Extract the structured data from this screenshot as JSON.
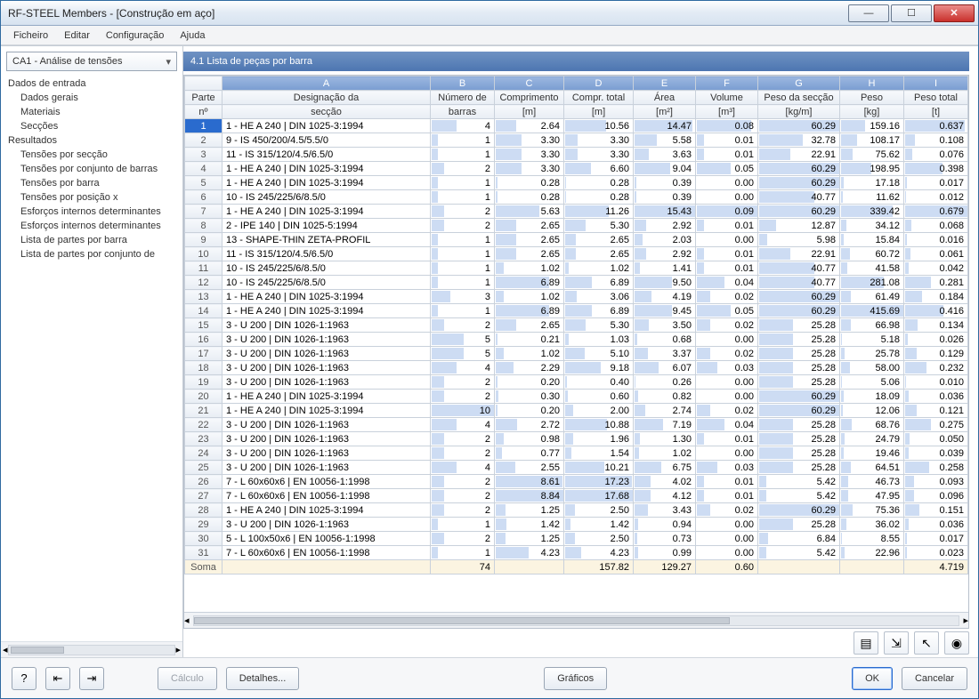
{
  "window": {
    "title": "RF-STEEL Members - [Construção em aço]"
  },
  "menu": [
    "Ficheiro",
    "Editar",
    "Configuração",
    "Ajuda"
  ],
  "sidebar": {
    "combo": "CA1 - Análise de tensões",
    "groups": [
      {
        "label": "Dados de entrada",
        "items": [
          "Dados gerais",
          "Materiais",
          "Secções"
        ]
      },
      {
        "label": "Resultados",
        "items": [
          "Tensões por secção",
          "Tensões por conjunto de barras",
          "Tensões por barra",
          "Tensões por posição x",
          "Esforços internos determinantes",
          "Esforços internos determinantes",
          "Lista de partes por barra",
          "Lista de partes por conjunto de"
        ]
      }
    ]
  },
  "panel": {
    "title": "4.1 Lista de peças por barra",
    "letters": [
      "A",
      "B",
      "C",
      "D",
      "E",
      "F",
      "G",
      "H",
      "I"
    ],
    "headers": [
      {
        "l1": "Parte",
        "l2": "nº"
      },
      {
        "l1": "Designação da",
        "l2": "secção"
      },
      {
        "l1": "Número de",
        "l2": "barras"
      },
      {
        "l1": "Comprimento",
        "l2": "[m]"
      },
      {
        "l1": "Compr. total",
        "l2": "[m]"
      },
      {
        "l1": "Área",
        "l2": "[m²]"
      },
      {
        "l1": "Volume",
        "l2": "[m³]"
      },
      {
        "l1": "Peso da secção",
        "l2": "[kg/m]"
      },
      {
        "l1": "Peso",
        "l2": "[kg]"
      },
      {
        "l1": "Peso total",
        "l2": "[t]"
      }
    ],
    "rows": [
      {
        "n": "1",
        "desc": "1 - HE A 240 | DIN 1025-3:1994",
        "nb": "4",
        "len": "2.64",
        "tot": "10.56",
        "area": "14.47",
        "vol": "0.08",
        "gw": "60.29",
        "w": "159.16",
        "wt": "0.637",
        "sel": true
      },
      {
        "n": "2",
        "desc": "9 - IS 450/200/4.5/5.5/0",
        "nb": "1",
        "len": "3.30",
        "tot": "3.30",
        "area": "5.58",
        "vol": "0.01",
        "gw": "32.78",
        "w": "108.17",
        "wt": "0.108"
      },
      {
        "n": "3",
        "desc": "11 - IS 315/120/4.5/6.5/0",
        "nb": "1",
        "len": "3.30",
        "tot": "3.30",
        "area": "3.63",
        "vol": "0.01",
        "gw": "22.91",
        "w": "75.62",
        "wt": "0.076"
      },
      {
        "n": "4",
        "desc": "1 - HE A 240 | DIN 1025-3:1994",
        "nb": "2",
        "len": "3.30",
        "tot": "6.60",
        "area": "9.04",
        "vol": "0.05",
        "gw": "60.29",
        "w": "198.95",
        "wt": "0.398"
      },
      {
        "n": "5",
        "desc": "1 - HE A 240 | DIN 1025-3:1994",
        "nb": "1",
        "len": "0.28",
        "tot": "0.28",
        "area": "0.39",
        "vol": "0.00",
        "gw": "60.29",
        "w": "17.18",
        "wt": "0.017"
      },
      {
        "n": "6",
        "desc": "10 - IS 245/225/6/8.5/0",
        "nb": "1",
        "len": "0.28",
        "tot": "0.28",
        "area": "0.39",
        "vol": "0.00",
        "gw": "40.77",
        "w": "11.62",
        "wt": "0.012"
      },
      {
        "n": "7",
        "desc": "1 - HE A 240 | DIN 1025-3:1994",
        "nb": "2",
        "len": "5.63",
        "tot": "11.26",
        "area": "15.43",
        "vol": "0.09",
        "gw": "60.29",
        "w": "339.42",
        "wt": "0.679"
      },
      {
        "n": "8",
        "desc": "2 - IPE 140 | DIN 1025-5:1994",
        "nb": "2",
        "len": "2.65",
        "tot": "5.30",
        "area": "2.92",
        "vol": "0.01",
        "gw": "12.87",
        "w": "34.12",
        "wt": "0.068"
      },
      {
        "n": "9",
        "desc": "13 - SHAPE-THIN ZETA-PROFIL",
        "nb": "1",
        "len": "2.65",
        "tot": "2.65",
        "area": "2.03",
        "vol": "0.00",
        "gw": "5.98",
        "w": "15.84",
        "wt": "0.016"
      },
      {
        "n": "10",
        "desc": "11 - IS 315/120/4.5/6.5/0",
        "nb": "1",
        "len": "2.65",
        "tot": "2.65",
        "area": "2.92",
        "vol": "0.01",
        "gw": "22.91",
        "w": "60.72",
        "wt": "0.061"
      },
      {
        "n": "11",
        "desc": "10 - IS 245/225/6/8.5/0",
        "nb": "1",
        "len": "1.02",
        "tot": "1.02",
        "area": "1.41",
        "vol": "0.01",
        "gw": "40.77",
        "w": "41.58",
        "wt": "0.042"
      },
      {
        "n": "12",
        "desc": "10 - IS 245/225/6/8.5/0",
        "nb": "1",
        "len": "6.89",
        "tot": "6.89",
        "area": "9.50",
        "vol": "0.04",
        "gw": "40.77",
        "w": "281.08",
        "wt": "0.281"
      },
      {
        "n": "13",
        "desc": "1 - HE A 240 | DIN 1025-3:1994",
        "nb": "3",
        "len": "1.02",
        "tot": "3.06",
        "area": "4.19",
        "vol": "0.02",
        "gw": "60.29",
        "w": "61.49",
        "wt": "0.184"
      },
      {
        "n": "14",
        "desc": "1 - HE A 240 | DIN 1025-3:1994",
        "nb": "1",
        "len": "6.89",
        "tot": "6.89",
        "area": "9.45",
        "vol": "0.05",
        "gw": "60.29",
        "w": "415.69",
        "wt": "0.416"
      },
      {
        "n": "15",
        "desc": "3 - U 200 | DIN 1026-1:1963",
        "nb": "2",
        "len": "2.65",
        "tot": "5.30",
        "area": "3.50",
        "vol": "0.02",
        "gw": "25.28",
        "w": "66.98",
        "wt": "0.134"
      },
      {
        "n": "16",
        "desc": "3 - U 200 | DIN 1026-1:1963",
        "nb": "5",
        "len": "0.21",
        "tot": "1.03",
        "area": "0.68",
        "vol": "0.00",
        "gw": "25.28",
        "w": "5.18",
        "wt": "0.026"
      },
      {
        "n": "17",
        "desc": "3 - U 200 | DIN 1026-1:1963",
        "nb": "5",
        "len": "1.02",
        "tot": "5.10",
        "area": "3.37",
        "vol": "0.02",
        "gw": "25.28",
        "w": "25.78",
        "wt": "0.129"
      },
      {
        "n": "18",
        "desc": "3 - U 200 | DIN 1026-1:1963",
        "nb": "4",
        "len": "2.29",
        "tot": "9.18",
        "area": "6.07",
        "vol": "0.03",
        "gw": "25.28",
        "w": "58.00",
        "wt": "0.232"
      },
      {
        "n": "19",
        "desc": "3 - U 200 | DIN 1026-1:1963",
        "nb": "2",
        "len": "0.20",
        "tot": "0.40",
        "area": "0.26",
        "vol": "0.00",
        "gw": "25.28",
        "w": "5.06",
        "wt": "0.010"
      },
      {
        "n": "20",
        "desc": "1 - HE A 240 | DIN 1025-3:1994",
        "nb": "2",
        "len": "0.30",
        "tot": "0.60",
        "area": "0.82",
        "vol": "0.00",
        "gw": "60.29",
        "w": "18.09",
        "wt": "0.036"
      },
      {
        "n": "21",
        "desc": "1 - HE A 240 | DIN 1025-3:1994",
        "nb": "10",
        "len": "0.20",
        "tot": "2.00",
        "area": "2.74",
        "vol": "0.02",
        "gw": "60.29",
        "w": "12.06",
        "wt": "0.121"
      },
      {
        "n": "22",
        "desc": "3 - U 200 | DIN 1026-1:1963",
        "nb": "4",
        "len": "2.72",
        "tot": "10.88",
        "area": "7.19",
        "vol": "0.04",
        "gw": "25.28",
        "w": "68.76",
        "wt": "0.275"
      },
      {
        "n": "23",
        "desc": "3 - U 200 | DIN 1026-1:1963",
        "nb": "2",
        "len": "0.98",
        "tot": "1.96",
        "area": "1.30",
        "vol": "0.01",
        "gw": "25.28",
        "w": "24.79",
        "wt": "0.050"
      },
      {
        "n": "24",
        "desc": "3 - U 200 | DIN 1026-1:1963",
        "nb": "2",
        "len": "0.77",
        "tot": "1.54",
        "area": "1.02",
        "vol": "0.00",
        "gw": "25.28",
        "w": "19.46",
        "wt": "0.039"
      },
      {
        "n": "25",
        "desc": "3 - U 200 | DIN 1026-1:1963",
        "nb": "4",
        "len": "2.55",
        "tot": "10.21",
        "area": "6.75",
        "vol": "0.03",
        "gw": "25.28",
        "w": "64.51",
        "wt": "0.258"
      },
      {
        "n": "26",
        "desc": "7 - L 60x60x6 | EN 10056-1:1998",
        "nb": "2",
        "len": "8.61",
        "tot": "17.23",
        "area": "4.02",
        "vol": "0.01",
        "gw": "5.42",
        "w": "46.73",
        "wt": "0.093"
      },
      {
        "n": "27",
        "desc": "7 - L 60x60x6 | EN 10056-1:1998",
        "nb": "2",
        "len": "8.84",
        "tot": "17.68",
        "area": "4.12",
        "vol": "0.01",
        "gw": "5.42",
        "w": "47.95",
        "wt": "0.096"
      },
      {
        "n": "28",
        "desc": "1 - HE A 240 | DIN 1025-3:1994",
        "nb": "2",
        "len": "1.25",
        "tot": "2.50",
        "area": "3.43",
        "vol": "0.02",
        "gw": "60.29",
        "w": "75.36",
        "wt": "0.151"
      },
      {
        "n": "29",
        "desc": "3 - U 200 | DIN 1026-1:1963",
        "nb": "1",
        "len": "1.42",
        "tot": "1.42",
        "area": "0.94",
        "vol": "0.00",
        "gw": "25.28",
        "w": "36.02",
        "wt": "0.036"
      },
      {
        "n": "30",
        "desc": "5 - L 100x50x6 | EN 10056-1:1998",
        "nb": "2",
        "len": "1.25",
        "tot": "2.50",
        "area": "0.73",
        "vol": "0.00",
        "gw": "6.84",
        "w": "8.55",
        "wt": "0.017"
      },
      {
        "n": "31",
        "desc": "7 - L 60x60x6 | EN 10056-1:1998",
        "nb": "1",
        "len": "4.23",
        "tot": "4.23",
        "area": "0.99",
        "vol": "0.00",
        "gw": "5.42",
        "w": "22.96",
        "wt": "0.023"
      }
    ],
    "soma": {
      "label": "Soma",
      "nb": "74",
      "tot": "157.82",
      "area": "129.27",
      "vol": "0.60",
      "wt": "4.719"
    }
  },
  "footer": {
    "calculo": "Cálculo",
    "detalhes": "Detalhes...",
    "graficos": "Gráficos",
    "ok": "OK",
    "cancelar": "Cancelar"
  },
  "max": {
    "nb": 10,
    "len": 8.84,
    "tot": 17.68,
    "area": 15.43,
    "vol": 0.09,
    "gw": 60.29,
    "w": 415.69,
    "wt": 0.679
  }
}
